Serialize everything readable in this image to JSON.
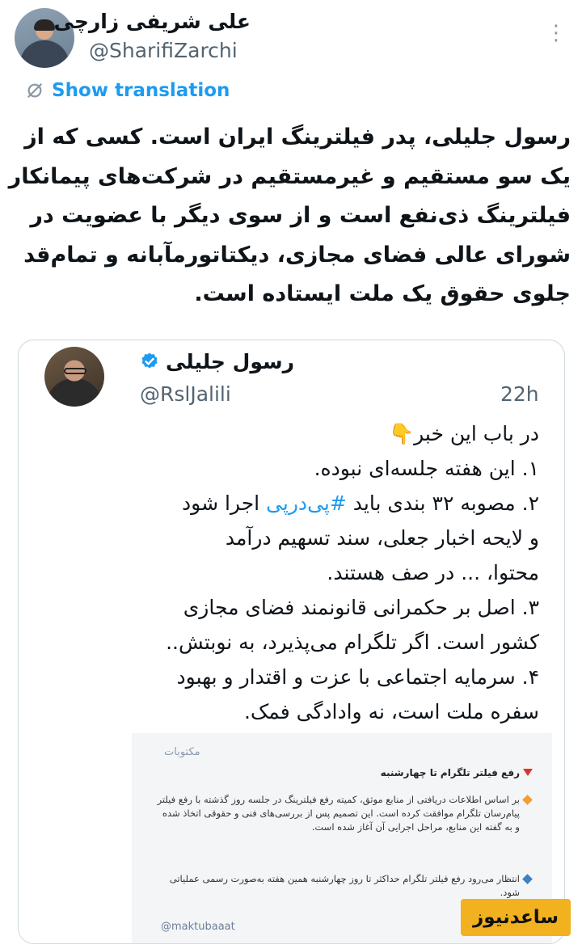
{
  "main_tweet": {
    "author_name": "علی شریفی زارچی",
    "handle": "@SharifiZarchi",
    "more_icon": "more-dots-icon",
    "translate_icon": "translate-slash-icon",
    "show_translation_label": "Show translation",
    "text_lines": [
      "رسول جلیلی، پدر فیلترینگ ایران است. کسی که از",
      "یک سو مستقیم و غیرمستقیم در شرکت‌های پیمانکار",
      "فیلترینگ ذی‌نفع است و از سوی دیگر با عضویت در",
      "شورای عالی فضای مجازی، دیکتاتورمآبانه و تمام‌قد",
      "جلوی حقوق یک ملت ایستاده است."
    ]
  },
  "quoted_tweet": {
    "author_name": "رسول جلیلی",
    "verified_icon": "verified-badge-icon",
    "handle": "@RslJalili",
    "time": "22h",
    "lines": {
      "l0": "در باب این خبر👇",
      "l1": "۱. این هفته جلسه‌ای نبوده.",
      "l2_pre": "۲. مصوبه ۳۲ بندی باید ",
      "l2_tag": "#پی‌درپی",
      "l2_post": " اجرا شود",
      "l3": "و لایحه اخبار جعلی، سند تسهیم درآمد",
      "l4": "محتوا، ... در صف هستند.",
      "l5": "۳. اصل بر حکمرانی قانونمند فضای مجازی",
      "l6": "کشور است. اگر تلگرام می‌پذیرد، به نوبتش..",
      "l7": "۴. سرمایه اجتماعی با عزت و اقتدار و بهبود",
      "l8": "سفره ملت است، نه وادادگی فمک."
    },
    "embed": {
      "brand": "مکتوبات",
      "title": "رفع فیلتر تلگرام تا چهارشنبه",
      "para1": "بر اساس اطلاعات دریافتی از منابع موثق، کمیته رفع فیلترینگ در جلسه روز گذشته با رفع فیلتر پیام‌رسان تلگرام موافقت کرده است. این تصمیم پس از بررسی‌های فنی و حقوقی اتخاذ شده و به گفته این منابع، مراحل اجرایی آن آغاز شده است.",
      "para2": "انتظار می‌رود رفع فیلتر تلگرام حداکثر تا روز چهارشنبه همین هفته به‌صورت رسمی عملیاتی شود.",
      "source": "@maktubaaat",
      "colors": {
        "bullet1": "#f0a030",
        "bullet2": "#3b82c4",
        "title_mark": "#d9362b"
      }
    }
  },
  "watermark": "ساعدنیوز",
  "colors": {
    "link": "#1d9bf0",
    "secondary_text": "#536471",
    "border": "#cfd9de",
    "watermark_bg": "#f2b11e"
  }
}
